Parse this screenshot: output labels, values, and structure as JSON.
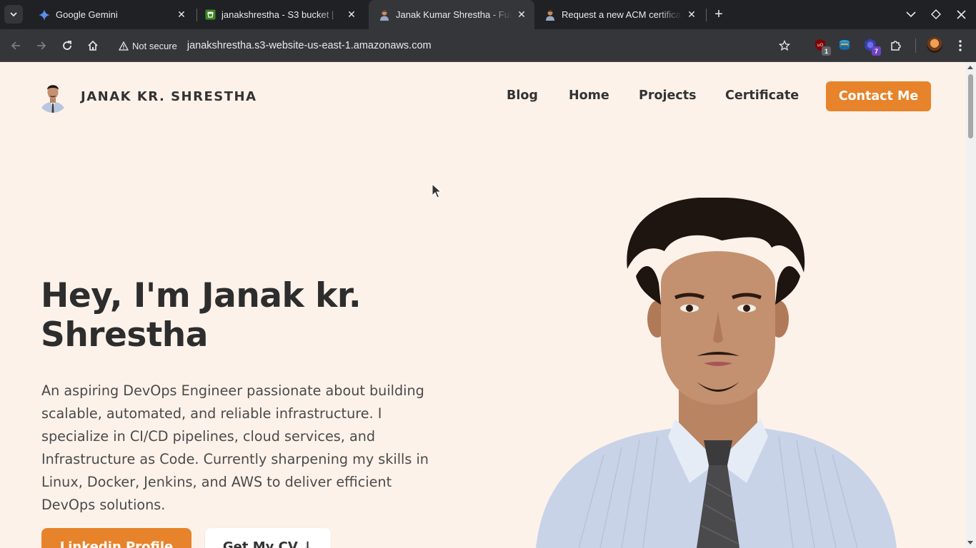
{
  "browser": {
    "tabs": [
      {
        "title": "Google Gemini",
        "favicon": "gemini-icon",
        "active": false
      },
      {
        "title": "janakshrestha - S3 bucket |",
        "favicon": "s3-bucket-icon",
        "active": false
      },
      {
        "title": "Janak Kumar Shrestha - Full",
        "favicon": "person-avatar-icon",
        "active": true
      },
      {
        "title": "Request a new ACM certifica",
        "favicon": "person-avatar-icon",
        "active": false
      }
    ],
    "security_label": "Not secure",
    "url": "janakshrestha.s3-website-us-east-1.amazonaws.com",
    "extension_badges": {
      "ublock": "1",
      "extension_count": "7"
    },
    "colors": {
      "tab_strip": "#202124",
      "toolbar": "#35363a",
      "text": "#e8eaed"
    }
  },
  "site": {
    "brand": "JANAK KR. SHRESTHA",
    "nav": [
      "Blog",
      "Home",
      "Projects",
      "Certificate"
    ],
    "contact_button": "Contact Me",
    "hero": {
      "title_line1": "Hey, I'm Janak kr.",
      "title_line2": "Shrestha",
      "description": "An aspiring DevOps Engineer passionate about building scalable, automated, and reliable infrastructure. I specialize in CI/CD pipelines, cloud services, and Infrastructure as Code. Currently sharpening my skills in Linux, Docker, Jenkins, and AWS to deliver efficient DevOps solutions.",
      "primary_button": "Linkedin Profile",
      "secondary_button": "Get My CV ↓"
    },
    "colors": {
      "background": "#fdf2ea",
      "accent": "#e7832a",
      "heading": "#2d2d2d"
    }
  }
}
